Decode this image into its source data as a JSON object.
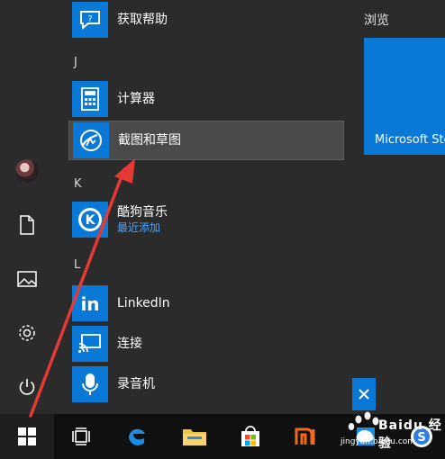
{
  "apps": {
    "help": {
      "name": "获取帮助"
    },
    "calculator": {
      "name": "计算器"
    },
    "snipping": {
      "name": "截图和草图"
    },
    "kugou": {
      "name": "酷狗音乐",
      "sub": "最近添加"
    },
    "linkedin": {
      "name": "LinkedIn"
    },
    "connect": {
      "name": "连接"
    },
    "recorder": {
      "name": "录音机"
    }
  },
  "letters": {
    "j": "J",
    "k": "K",
    "l": "L"
  },
  "right": {
    "title": "浏览",
    "store_tile": "Microsoft Store"
  },
  "watermark": {
    "text": "Baidu 经验",
    "sub": "jingyan.baidu.com"
  },
  "colors": {
    "accent": "#0a78d7",
    "highlight": "#4a4a4a",
    "taskbar": "#101010",
    "arrow": "#e53935"
  }
}
